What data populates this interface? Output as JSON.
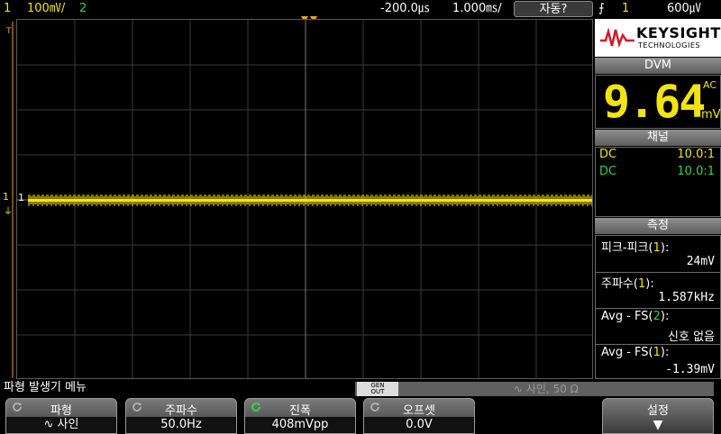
{
  "topbar": {
    "ch1_num": "1",
    "ch1_scale": "100㎷/",
    "ch2_num": "2",
    "delay": "-200.0㎲",
    "timebase": "1.000㎳/",
    "trigger_mode": "자동?",
    "trigger_source": "1",
    "trigger_level": "600㎶"
  },
  "scope": {
    "channel_marker": "1",
    "trigger_marker": "T"
  },
  "panel": {
    "brand": "KEYSIGHT",
    "brand_sub": "TECHNOLOGIES",
    "dvm_title": "DVM",
    "dvm_value": "9.64",
    "dvm_mode": "AC",
    "dvm_unit": "mV",
    "channels_title": "채널",
    "channels": [
      {
        "coupling": "DC",
        "probe": "10.0:1",
        "color": "#f2e40f"
      },
      {
        "coupling": "DC",
        "probe": "10.0:1",
        "color": "#35d24a"
      }
    ],
    "meas_title": "측정",
    "measurements": [
      {
        "name": "피크-피크",
        "ch": "1",
        "value": "24mV"
      },
      {
        "name": "주파수",
        "ch": "1",
        "value": "1.587kHz"
      },
      {
        "name": "Avg - FS",
        "ch": "2",
        "value": "신호 없음"
      },
      {
        "name": "Avg - FS",
        "ch": "1",
        "value": "-1.39mV"
      }
    ]
  },
  "menu": {
    "title": "파형 발생기 메뉴",
    "gen_out_line1": "GEN",
    "gen_out_line2": "OUT",
    "gen_summary": "사인, 50 Ω",
    "softkeys": [
      {
        "top": "파형",
        "bottom": "사인"
      },
      {
        "top": "주파수",
        "bottom": "50.0Hz"
      },
      {
        "top": "진폭",
        "bottom": "408mVpp"
      },
      {
        "top": "오프셋",
        "bottom": "0.0V"
      },
      {
        "top": "설정",
        "bottom": ""
      }
    ]
  },
  "colors": {
    "ch1": "#f2e40f",
    "ch2": "#35d24a",
    "trigger": "#f39c2b",
    "brand_red": "#d6182a"
  }
}
